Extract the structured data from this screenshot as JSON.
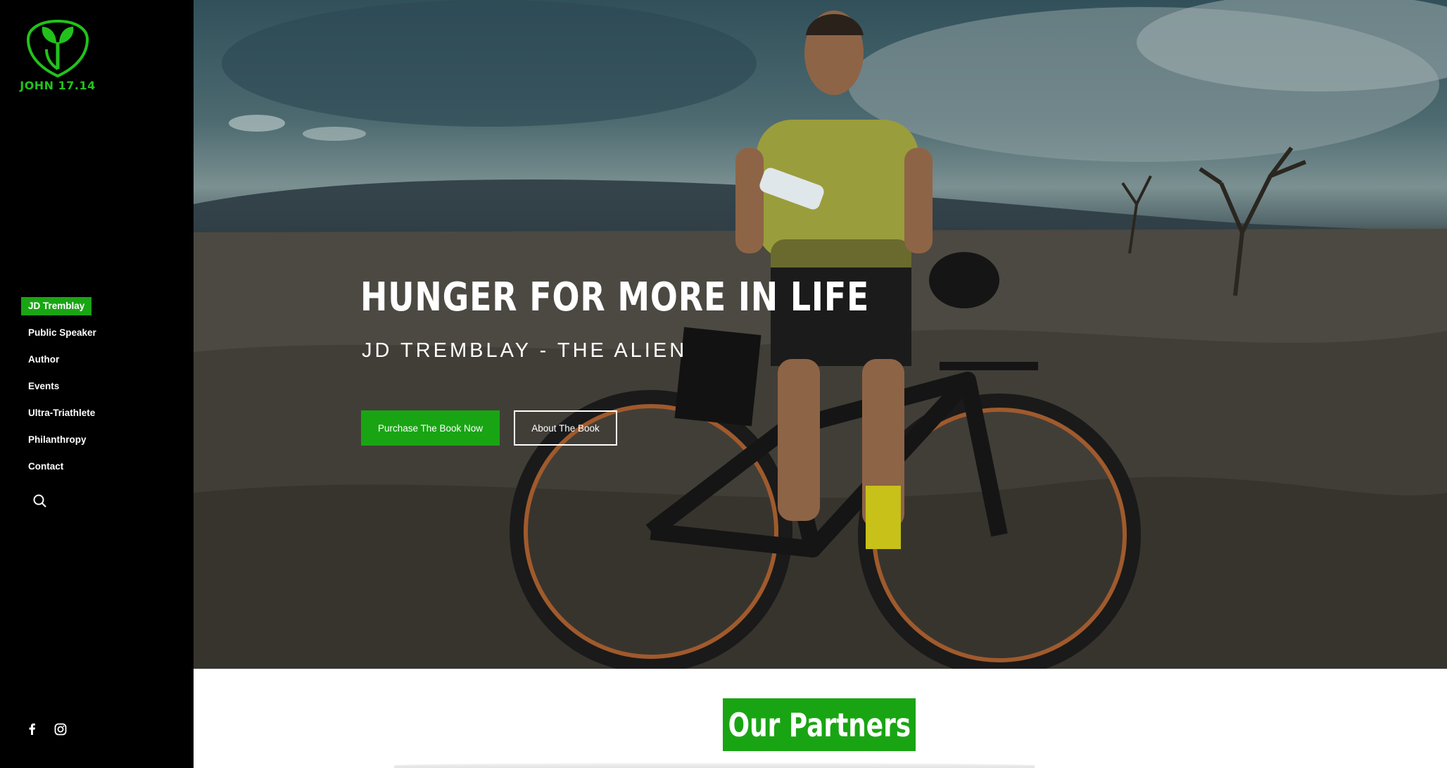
{
  "sidebar": {
    "logo_text": "JOHN 17.14",
    "nav": [
      {
        "label": "JD Tremblay",
        "active": true
      },
      {
        "label": "Public Speaker"
      },
      {
        "label": "Author"
      },
      {
        "label": "Events"
      },
      {
        "label": "Ultra-Triathlete"
      },
      {
        "label": "Philanthropy"
      },
      {
        "label": "Contact"
      }
    ],
    "social_icons": [
      "facebook-icon",
      "instagram-icon"
    ]
  },
  "hero": {
    "title": "HUNGER FOR MORE IN LIFE",
    "subtitle": "JD TREMBLAY - THE ALIEN",
    "primary_button": "Purchase The Book Now",
    "secondary_button": "About The Book"
  },
  "partners": {
    "heading": "Our Partners"
  },
  "colors": {
    "accent": "#19a513",
    "logo_green": "#22c21c",
    "sidebar_bg": "#000000"
  }
}
